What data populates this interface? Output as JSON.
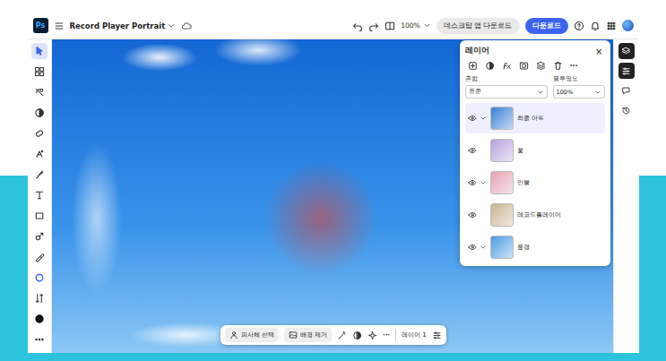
{
  "window": {
    "title": "Record Player Portrait",
    "zoom": "100%",
    "logo": "Ps"
  },
  "header_buttons": [
    {
      "label": "데스크탑 앱 다운로드",
      "primary": false
    },
    {
      "label": "다운로드",
      "primary": true
    }
  ],
  "tools": [
    {
      "selected": true
    },
    {
      "selected": false
    },
    {
      "selected": false
    },
    {
      "selected": false
    },
    {
      "selected": false
    },
    {
      "selected": false
    },
    {
      "selected": false
    },
    {
      "selected": false
    },
    {
      "selected": false
    },
    {
      "selected": false
    },
    {
      "selected": false
    },
    {
      "selected": false
    },
    {
      "selected": false
    },
    {
      "selected": false
    },
    {
      "selected": false
    }
  ],
  "right_rail": [
    {
      "selected": true
    },
    {
      "selected": true
    },
    {
      "selected": false
    },
    {
      "selected": false
    }
  ],
  "layers_panel": {
    "title": "레이어",
    "close": "×",
    "more": "···",
    "blend_label": "혼합",
    "blend_value": "표준",
    "opacity_label": "불투명도",
    "opacity_value": "100%",
    "layers": [
      {
        "name": "최종 아트",
        "visible": true,
        "kind": "group",
        "selected": true,
        "color": "#3b7fd6"
      },
      {
        "name": "꽃",
        "visible": true,
        "kind": "layer",
        "selected": false,
        "color": "#b9a3dc"
      },
      {
        "name": "인물",
        "visible": true,
        "kind": "group",
        "selected": false,
        "color": "#e6a3b4"
      },
      {
        "name": "레코드플레이어",
        "visible": true,
        "kind": "layer",
        "selected": false,
        "color": "#c9b493"
      },
      {
        "name": "풍경",
        "visible": true,
        "kind": "group",
        "selected": false,
        "color": "#4d9be0"
      }
    ]
  },
  "taskbar": {
    "buttons": [
      {
        "label": "피사체 선택"
      },
      {
        "label": "배경 제거"
      }
    ],
    "more": "···",
    "layer_label": "레이어 1"
  }
}
